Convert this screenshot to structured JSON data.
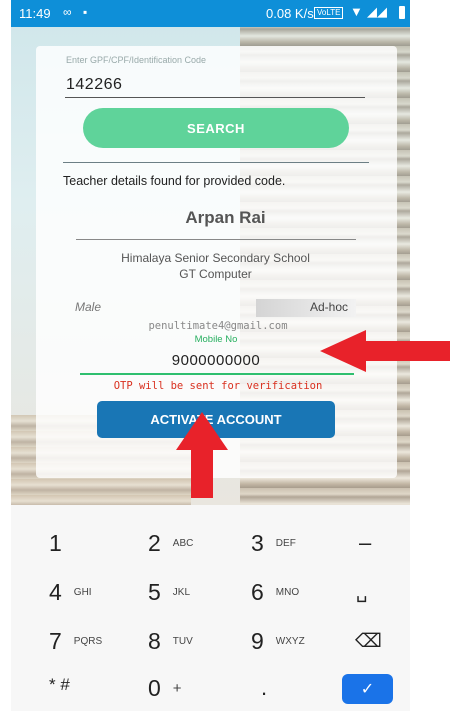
{
  "status_bar": {
    "time": "11:49",
    "notif_icon_1": "voicemail-icon",
    "notif_icon_2": "image-icon",
    "network_speed": "0.08 K/s",
    "volte": "VoLTE"
  },
  "form": {
    "code_label": "Enter GPF/CPF/Identification Code",
    "code_value": "142266",
    "search_label": "SEARCH",
    "found_text": "Teacher details found for provided code.",
    "teacher_name": "Arpan Rai",
    "school_line1": "Himalaya Senior Secondary School",
    "school_line2": "GT Computer",
    "gender": "Male",
    "employment_type": "Ad-hoc",
    "email": "penultimate4@gmail.com",
    "mobile_label": "Mobile No",
    "mobile_value": "9000000000",
    "otp_note": "OTP will be sent for verification",
    "activate_label": "ACTIVATE ACCOUNT"
  },
  "keypad": {
    "rows": [
      [
        {
          "d": "1",
          "l": ""
        },
        {
          "d": "2",
          "l": "ABC"
        },
        {
          "d": "3",
          "l": "DEF"
        },
        {
          "d": "–",
          "l": ""
        }
      ],
      [
        {
          "d": "4",
          "l": "GHI"
        },
        {
          "d": "5",
          "l": "JKL"
        },
        {
          "d": "6",
          "l": "MNO"
        },
        {
          "d": "␣",
          "l": ""
        }
      ],
      [
        {
          "d": "7",
          "l": "PQRS"
        },
        {
          "d": "8",
          "l": "TUV"
        },
        {
          "d": "9",
          "l": "WXYZ"
        },
        {
          "d": "⌫",
          "l": ""
        }
      ],
      [
        {
          "d": "* #",
          "l": ""
        },
        {
          "d": "0",
          "l": "+"
        },
        {
          "d": ".",
          "l": ""
        },
        {
          "d": "✓",
          "l": ""
        }
      ]
    ]
  },
  "colors": {
    "status_bar": "#0e8fd8",
    "search_button": "#5fd39a",
    "activate_button": "#1976b5",
    "arrow": "#e8222a",
    "done_key": "#1a73e8"
  }
}
